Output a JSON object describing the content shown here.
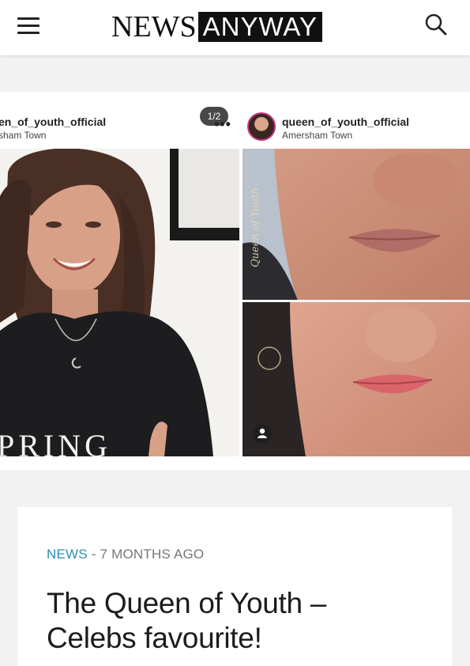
{
  "header": {
    "logo_news": "NEWS",
    "logo_anyway": "ANYWAY",
    "menu_icon": "hamburger-menu-icon",
    "search_icon": "search-icon"
  },
  "instagram": {
    "left_username": "en_of_youth_official",
    "left_location": "sham Town",
    "more_icon": "more-dots-icon",
    "right_username": "queen_of_youth_official",
    "right_location": "Amersham Town",
    "slide_counter": "1/2",
    "sweater_text": "PRING",
    "watermark_text": "Queen of Youth",
    "person_icon": "person-tag-icon"
  },
  "article": {
    "category": "NEWS",
    "separator": " - ",
    "time_ago": "7 MONTHS AGO",
    "title": "The Queen of Youth – Celebs favourite!"
  },
  "colors": {
    "accent": "#2b8fb2",
    "logo_bg": "#111111"
  }
}
